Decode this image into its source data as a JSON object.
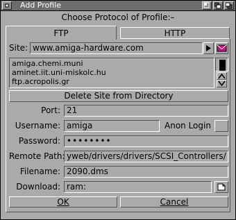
{
  "window": {
    "title": "Add Profile"
  },
  "heading": "Choose Protocol of Profile:–",
  "tabs": [
    {
      "label": "FTP"
    },
    {
      "label": "HTTP"
    }
  ],
  "site": {
    "label": "Site:",
    "value": "www.amiga-hardware.com"
  },
  "directory": {
    "items": [
      "amiga.chemi.muni",
      "aminet.iit.uni-miskolc.hu",
      "ftp.acropolis.gr"
    ]
  },
  "delete_button": "Delete Site from Directory",
  "port": {
    "label": "Port:",
    "value": "21"
  },
  "username": {
    "label": "Username:",
    "value": "amiga"
  },
  "anon_login": {
    "label": "Anon Login",
    "checked": false
  },
  "password": {
    "label": "Password:",
    "value": "••••••••"
  },
  "remote_path": {
    "label": "Remote Path:",
    "value": "yweb/drivers/drivers/SCSI_Controllers/"
  },
  "filename": {
    "label": "Filename:",
    "value": "2090.dms"
  },
  "download": {
    "label": "Download:",
    "value": "ram:"
  },
  "buttons": {
    "ok": "OK",
    "cancel": "Cancel"
  },
  "colors": {
    "background": "#aaaaaa",
    "titlebar": "#6c6c6c",
    "mail_icon": "#c0187a"
  }
}
